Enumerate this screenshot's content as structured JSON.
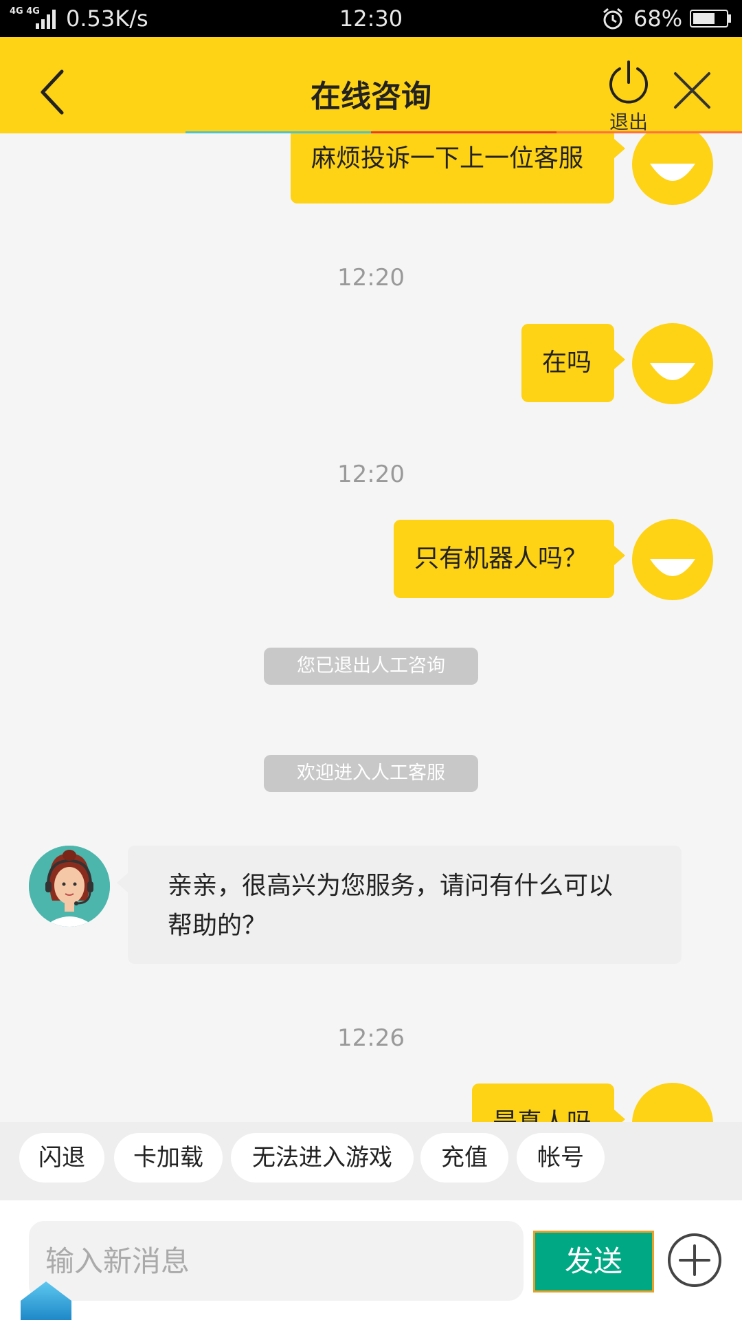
{
  "status_bar": {
    "network": "4G 4G",
    "speed": "0.53K/s",
    "time": "12:30",
    "battery_percent": "68%",
    "battery_level": 0.68
  },
  "header": {
    "title": "在线咨询",
    "exit_label": "退出",
    "icons": [
      "back-arrow-icon",
      "power-icon",
      "close-icon"
    ]
  },
  "chat": {
    "messages": [
      {
        "type": "outgoing",
        "text": "麻烦投诉一下上一位客服"
      },
      {
        "type": "timestamp",
        "text": "12:20"
      },
      {
        "type": "outgoing",
        "text": "在吗"
      },
      {
        "type": "timestamp",
        "text": "12:20"
      },
      {
        "type": "outgoing",
        "text": "只有机器人吗？"
      },
      {
        "type": "system",
        "text": "您已退出人工咨询"
      },
      {
        "type": "system",
        "text": "欢迎进入人工客服"
      },
      {
        "type": "incoming",
        "lines": [
          "亲亲，很高兴为您服务，请问有什么可以",
          "帮助的？"
        ]
      },
      {
        "type": "timestamp",
        "text": "12:26"
      },
      {
        "type": "outgoing",
        "text": "是真人吗"
      }
    ]
  },
  "quick_tags": [
    "闪退",
    "卡加载",
    "无法进入游戏",
    "充值",
    "帐号"
  ],
  "input": {
    "placeholder": "输入新消息",
    "value": "",
    "send_label": "发送"
  },
  "colors": {
    "brand_yellow": "#fed215",
    "send_green": "#00a884",
    "pill_gray": "#c8c8c8",
    "incoming_bubble": "#efefef"
  }
}
